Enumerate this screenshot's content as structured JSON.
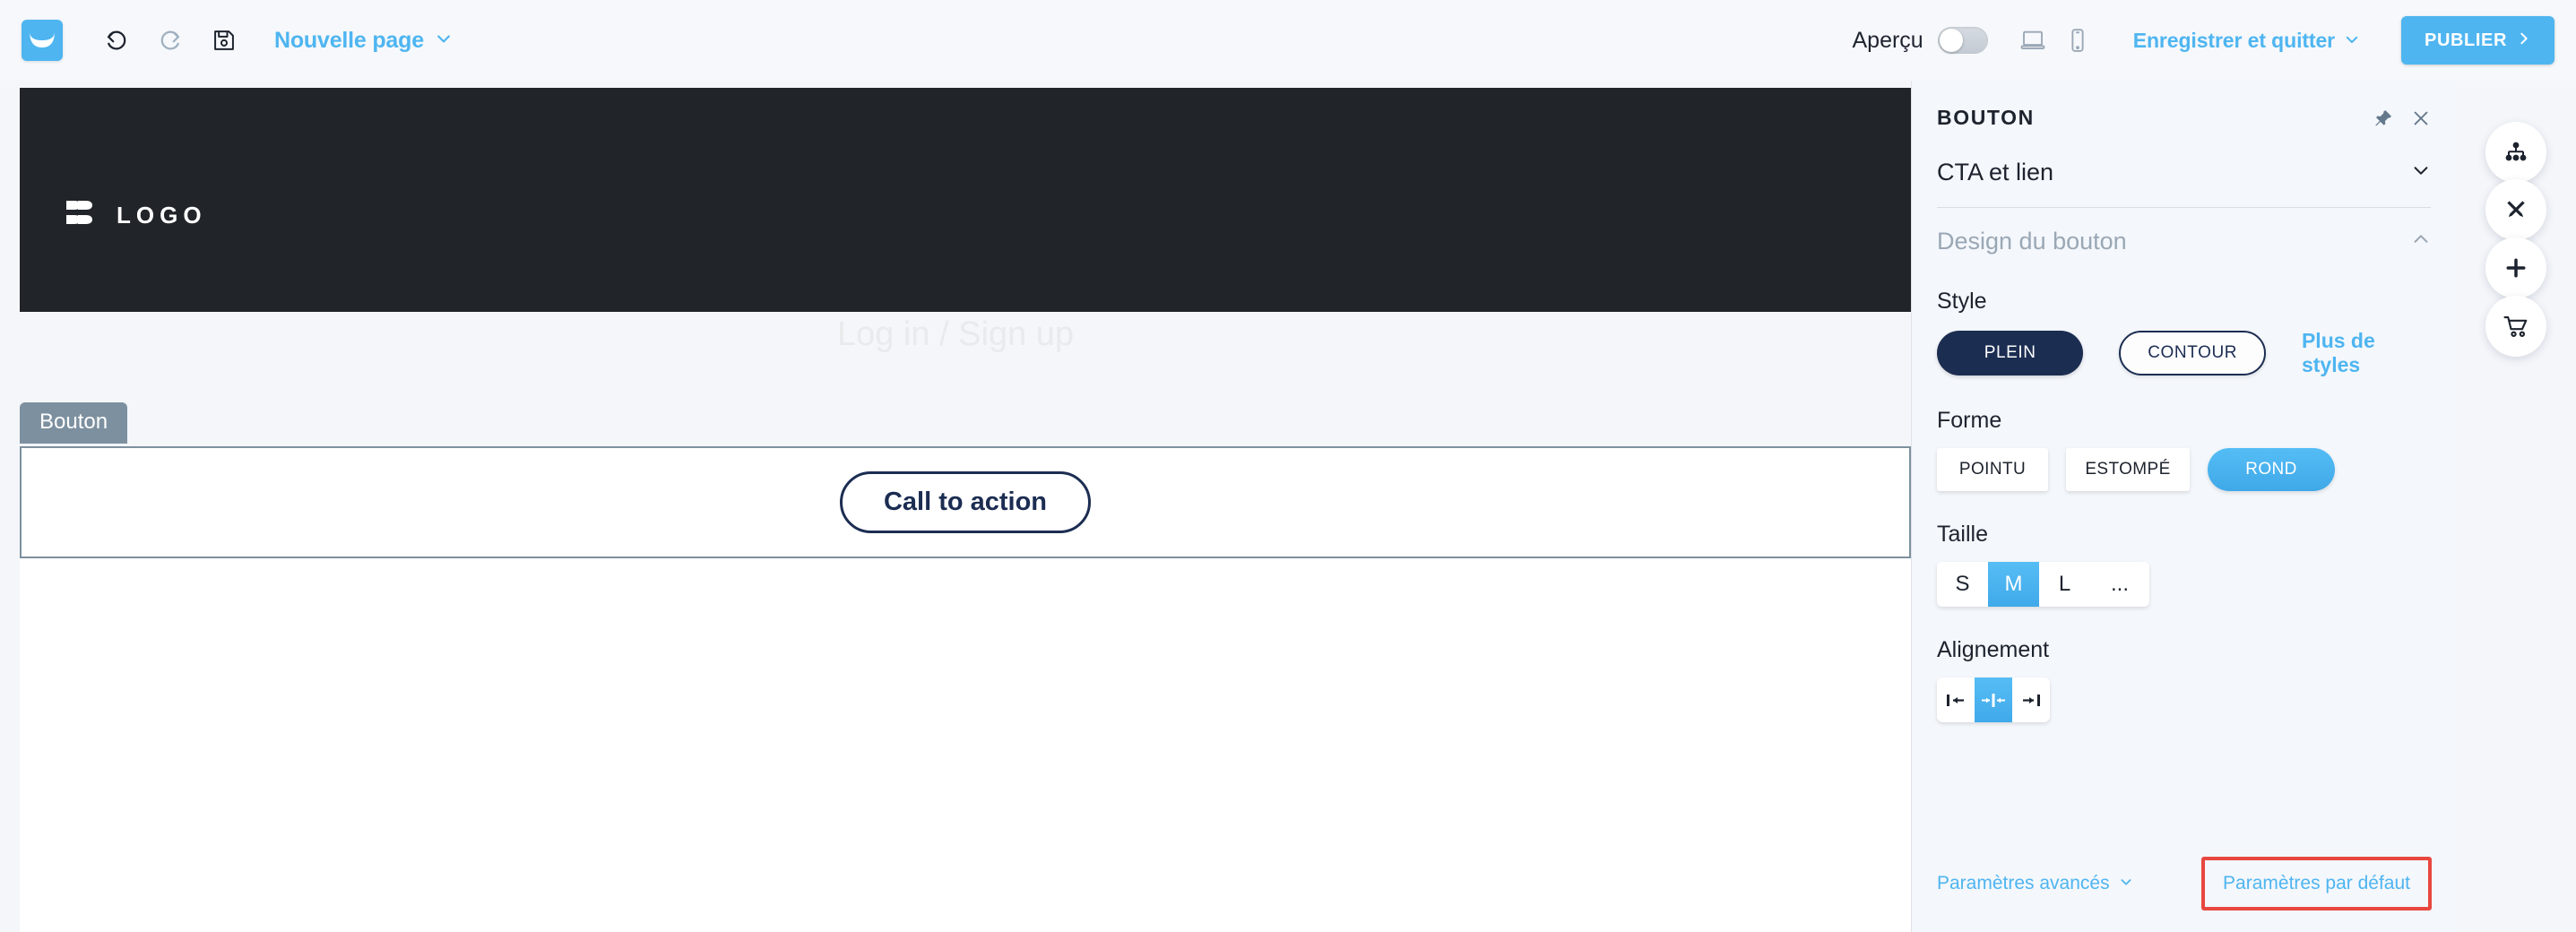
{
  "topbar": {
    "brand_icon": "mailchimp-envelope-logo",
    "undo_icon": "undo-arrow-icon",
    "redo_icon": "redo-arrow-icon",
    "save_icon": "floppy-disk-save-icon",
    "page_name": "Nouvelle page",
    "page_name_chevron": "chevron-down-icon",
    "preview_label": "Aperçu",
    "preview_toggle_state": "off",
    "desktop_icon": "laptop-icon",
    "mobile_icon": "mobile-phone-icon",
    "save_quit_label": "Enregistrer et quitter",
    "save_quit_chevron": "chevron-down-icon",
    "publish_label": "PUBLIER",
    "publish_chevron": "chevron-right-icon",
    "accent_blue": "#4eb5f1"
  },
  "canvas": {
    "logo_text": "LOGO",
    "logo_icon": "brand-b-mark-icon",
    "hero_title": "Log in / Sign up",
    "header_bg": "#212429",
    "block_tab_label": "Bouton",
    "block_tab_bg": "#7d909f",
    "cta_button_label": "Call to action",
    "cta_button_color": "#1c2d52"
  },
  "panel": {
    "title": "BOUTON",
    "pin_icon": "pushpin-icon",
    "close_icon": "close-x-icon",
    "sections": [
      {
        "label": "CTA et lien",
        "chevron": "chevron-down-icon",
        "expanded": false
      },
      {
        "label": "Design du bouton",
        "chevron": "chevron-up-icon",
        "expanded": true
      }
    ],
    "style": {
      "label": "Style",
      "options": [
        {
          "label": "PLEIN",
          "selected": true
        },
        {
          "label": "CONTOUR",
          "selected": false
        }
      ],
      "more_styles_link": "Plus de styles"
    },
    "forme": {
      "label": "Forme",
      "options": [
        {
          "label": "POINTU",
          "selected": false
        },
        {
          "label": "ESTOMPÉ",
          "selected": false
        },
        {
          "label": "ROND",
          "selected": true
        }
      ]
    },
    "taille": {
      "label": "Taille",
      "options": [
        {
          "label": "S",
          "selected": false
        },
        {
          "label": "M",
          "selected": true
        },
        {
          "label": "L",
          "selected": false
        },
        {
          "label": "...",
          "selected": false
        }
      ]
    },
    "alignement": {
      "label": "Alignement",
      "options": [
        {
          "icon": "align-left-icon",
          "selected": false
        },
        {
          "icon": "align-center-icon",
          "selected": true
        },
        {
          "icon": "align-right-icon",
          "selected": false
        }
      ]
    },
    "footer": {
      "advanced_label": "Paramètres avancés",
      "advanced_chevron": "chevron-down-icon",
      "default_label": "Paramètres par défaut",
      "default_highlight_color": "#e8473f"
    }
  },
  "rail": {
    "buttons": [
      {
        "icon": "sitemap-icon"
      },
      {
        "icon": "design-pencils-icon"
      },
      {
        "icon": "plus-icon"
      },
      {
        "icon": "shopping-cart-icon"
      }
    ]
  }
}
